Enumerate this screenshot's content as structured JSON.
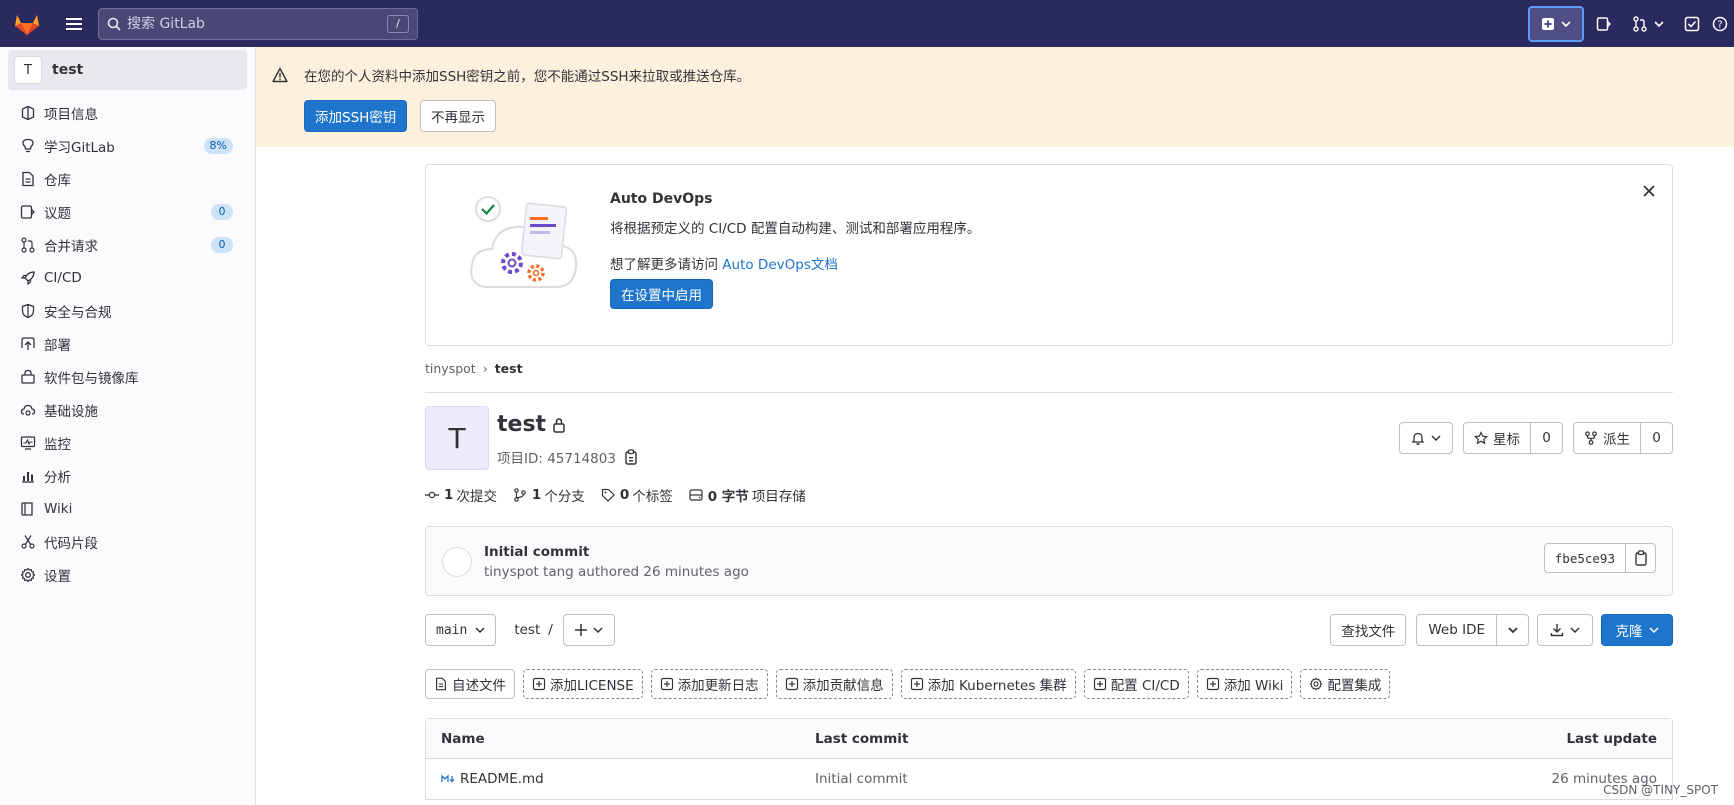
{
  "topbar": {
    "search_placeholder": "搜索 GitLab",
    "search_shortcut": "/"
  },
  "sidebar": {
    "project_avatar": "T",
    "project_name": "test",
    "items": [
      {
        "label": "项目信息",
        "icon": "project-info-icon"
      },
      {
        "label": "学习GitLab",
        "icon": "bulb-icon",
        "badge": "8%"
      },
      {
        "label": "仓库",
        "icon": "document-icon"
      },
      {
        "label": "议题",
        "icon": "issues-icon",
        "badge": "0"
      },
      {
        "label": "合并请求",
        "icon": "merge-request-icon",
        "badge": "0"
      },
      {
        "label": "CI/CD",
        "icon": "rocket-icon"
      },
      {
        "label": "安全与合规",
        "icon": "shield-icon"
      },
      {
        "label": "部署",
        "icon": "deploy-icon"
      },
      {
        "label": "软件包与镜像库",
        "icon": "package-icon"
      },
      {
        "label": "基础设施",
        "icon": "cloud-gear-icon"
      },
      {
        "label": "监控",
        "icon": "monitor-icon"
      },
      {
        "label": "分析",
        "icon": "chart-icon"
      },
      {
        "label": "Wiki",
        "icon": "book-icon"
      },
      {
        "label": "代码片段",
        "icon": "snippet-icon"
      },
      {
        "label": "设置",
        "icon": "settings-icon"
      }
    ]
  },
  "alert": {
    "message": "在您的个人资料中添加SSH密钥之前，您不能通过SSH来拉取或推送仓库。",
    "primary_label": "添加SSH密钥",
    "dismiss_label": "不再显示"
  },
  "devops": {
    "title": "Auto DevOps",
    "description": "将根据预定义的 CI/CD 配置自动构建、测试和部署应用程序。",
    "more_prefix": "想了解更多请访问 ",
    "more_link": "Auto DevOps文档",
    "enable_label": "在设置中启用"
  },
  "breadcrumb": {
    "group": "tinyspot",
    "separator": "›",
    "current": "test"
  },
  "project": {
    "avatar": "T",
    "name": "test",
    "id_label": "项目ID: 45714803",
    "star_label": "星标",
    "star_count": "0",
    "fork_label": "派生",
    "fork_count": "0"
  },
  "stats": {
    "commits_num": "1",
    "commits_label": "次提交",
    "branches_num": "1",
    "branches_label": "个分支",
    "tags_num": "0",
    "tags_label": "个标签",
    "storage_num": "0 字节",
    "storage_label": "项目存储"
  },
  "commit": {
    "title": "Initial commit",
    "author": "tinyspot tang",
    "action": " authored 26 minutes ago",
    "sha": "fbe5ce93"
  },
  "repo": {
    "branch": "main",
    "path": "test",
    "path_sep": "/",
    "find_file": "查找文件",
    "web_ide": "Web IDE",
    "clone": "克隆"
  },
  "quick_actions": [
    {
      "label": "自述文件",
      "icon": "document-icon",
      "style": "solid"
    },
    {
      "label": "添加LICENSE",
      "icon": "plus-square-icon",
      "style": "dashed"
    },
    {
      "label": "添加更新日志",
      "icon": "plus-square-icon",
      "style": "dashed"
    },
    {
      "label": "添加贡献信息",
      "icon": "plus-square-icon",
      "style": "dashed"
    },
    {
      "label": "添加 Kubernetes 集群",
      "icon": "plus-square-icon",
      "style": "dashed"
    },
    {
      "label": "配置 CI/CD",
      "icon": "plus-square-icon",
      "style": "dashed"
    },
    {
      "label": "添加 Wiki",
      "icon": "plus-square-icon",
      "style": "dashed"
    },
    {
      "label": "配置集成",
      "icon": "settings-icon",
      "style": "dashed"
    }
  ],
  "table": {
    "headers": {
      "name": "Name",
      "last_commit": "Last commit",
      "last_update": "Last update"
    },
    "rows": [
      {
        "name": "README.md",
        "last_commit": "Initial commit",
        "last_update": "26 minutes ago"
      }
    ]
  },
  "watermark": "CSDN @TINY_SPOT",
  "colors": {
    "navbar": "#2b2a5f",
    "primary": "#1f75cb",
    "alert_bg": "#fdf1dd"
  }
}
